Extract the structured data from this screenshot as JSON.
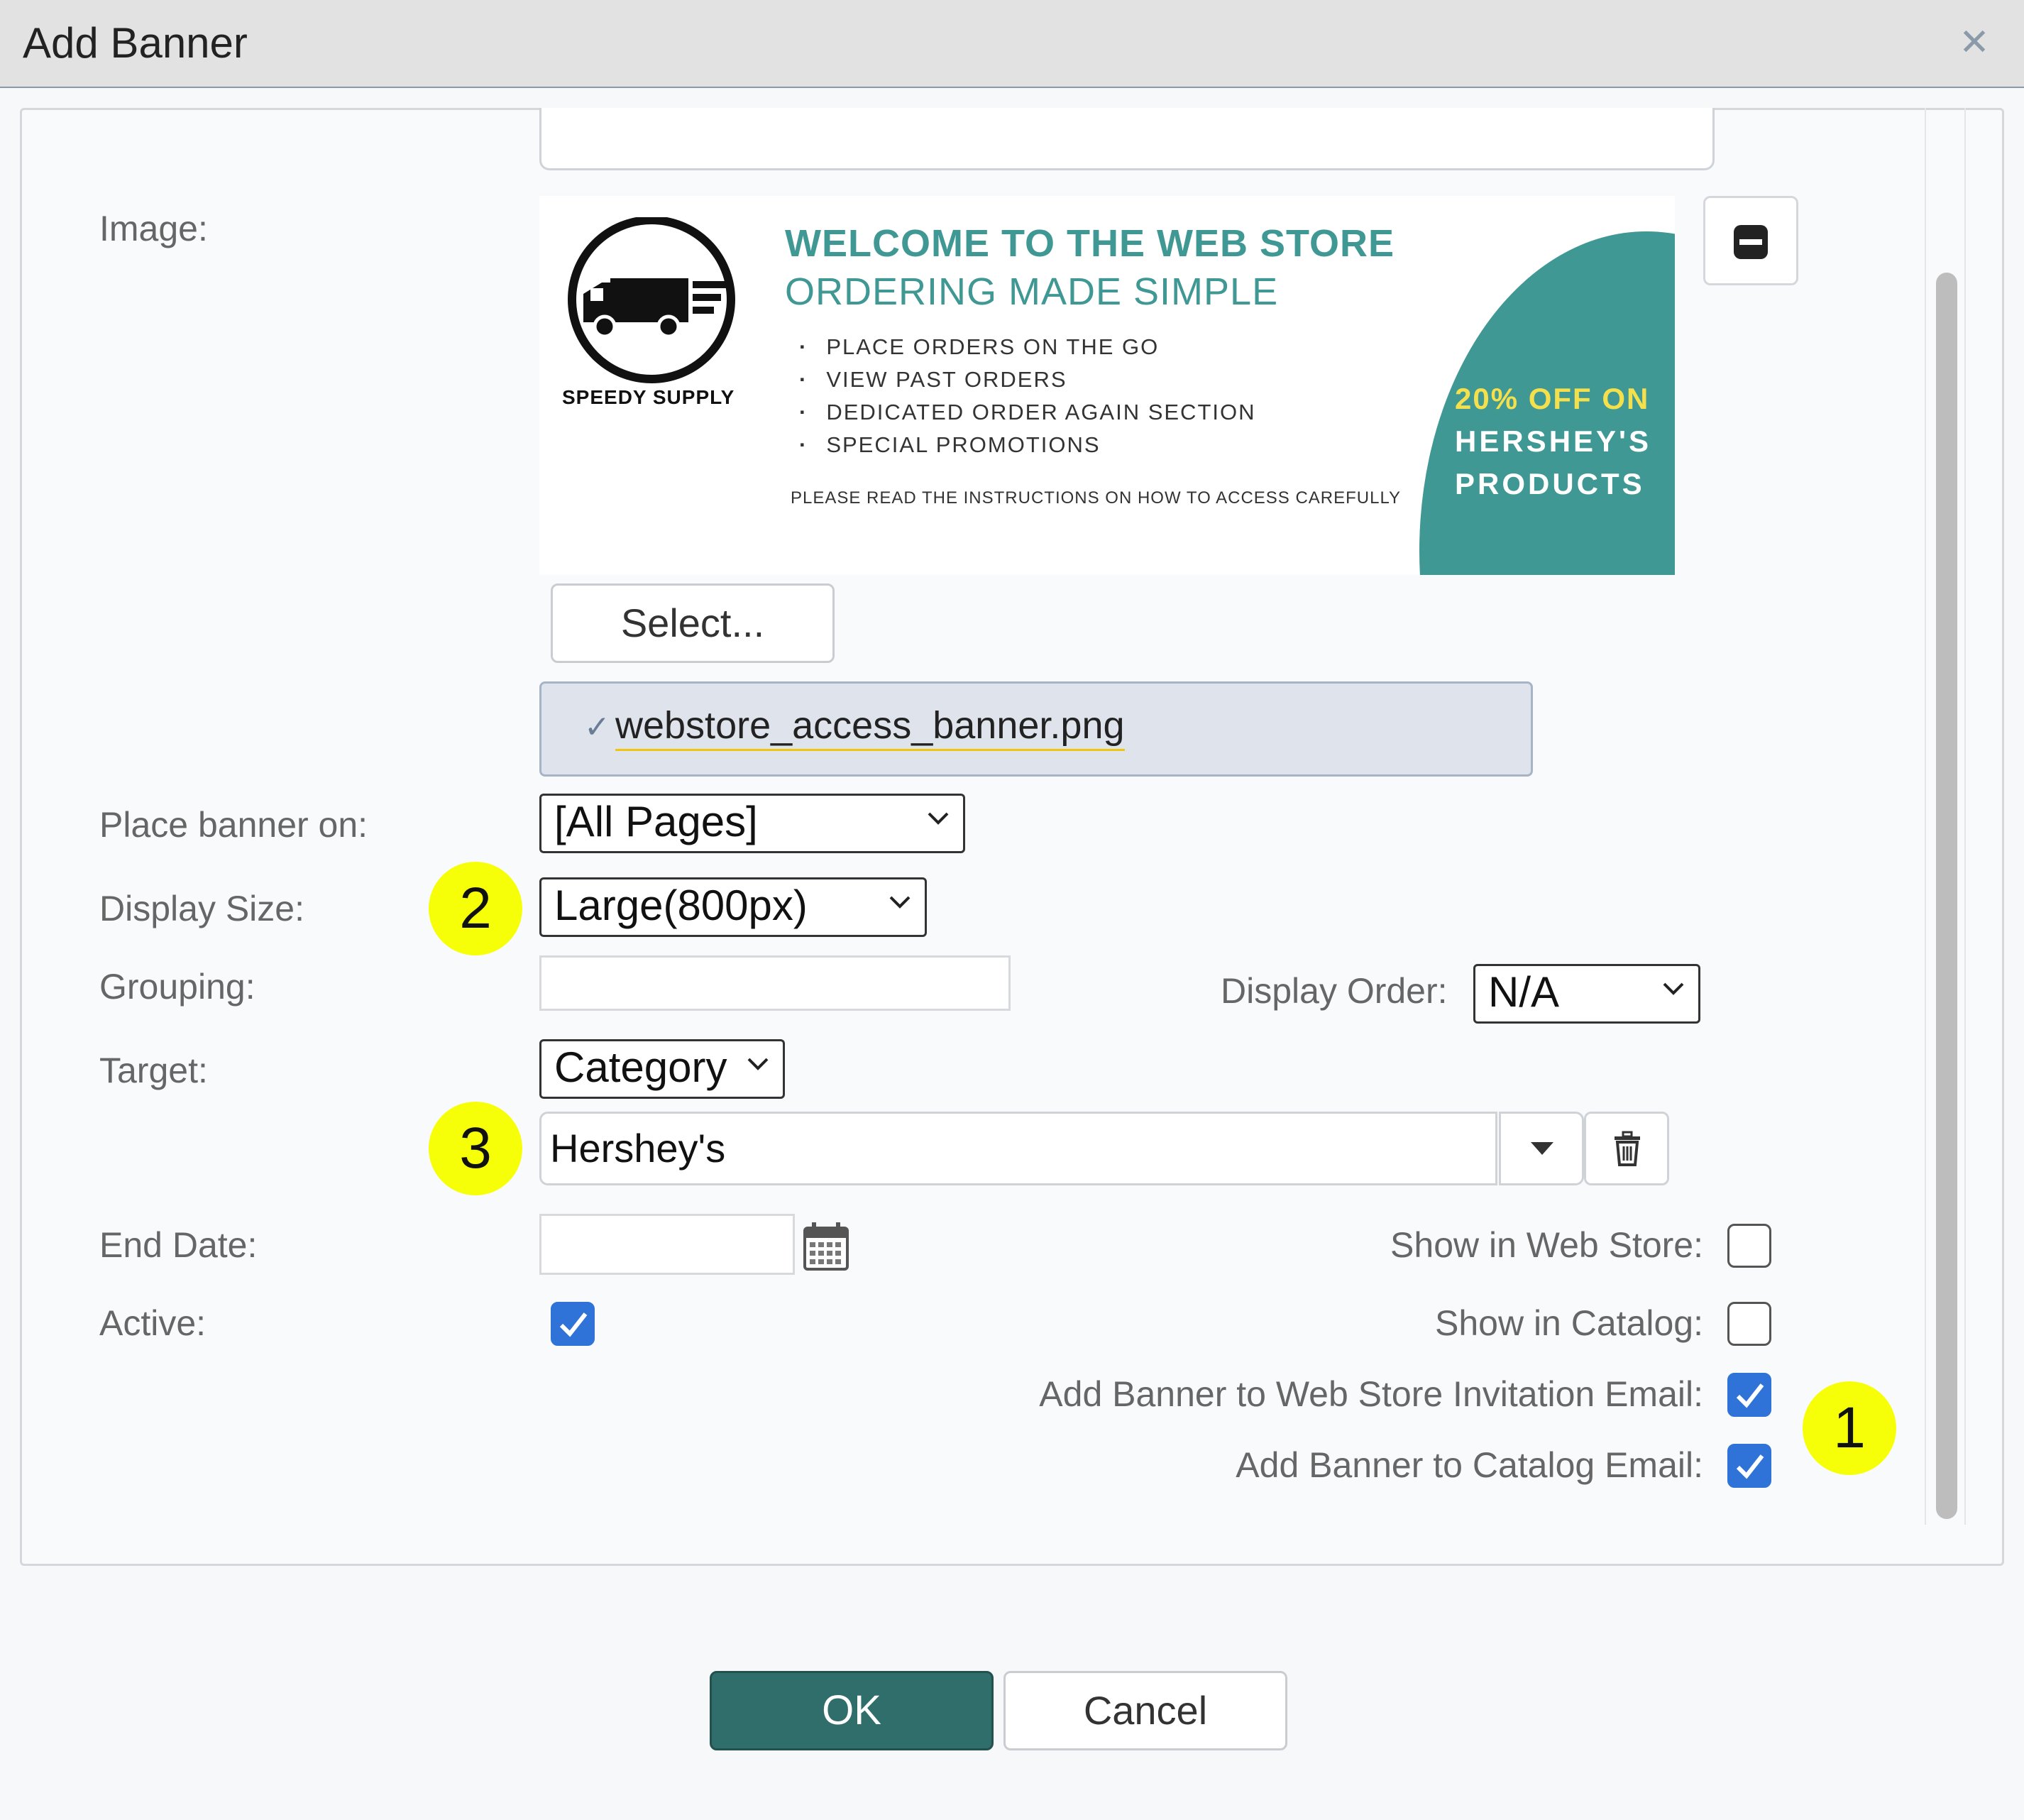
{
  "dialog": {
    "title": "Add Banner"
  },
  "image": {
    "label": "Image:",
    "banner": {
      "brand": "SPEEDY SUPPLY",
      "headline": "WELCOME TO THE WEB STORE",
      "subheadline": "ORDERING MADE SIMPLE",
      "bullets": [
        "PLACE ORDERS ON THE GO",
        "VIEW PAST ORDERS",
        "DEDICATED ORDER AGAIN SECTION",
        "SPECIAL PROMOTIONS"
      ],
      "note": "PLEASE READ THE INSTRUCTIONS ON HOW TO ACCESS CAREFULLY",
      "promo_line1": "20% OFF ON",
      "promo_line2": "HERSHEY'S",
      "promo_line3": "PRODUCTS"
    },
    "select_label": "Select...",
    "file_name": "webstore_access_banner.png"
  },
  "form": {
    "place_banner_on": {
      "label": "Place banner on:",
      "value": "[All Pages]"
    },
    "display_size": {
      "label": "Display Size:",
      "value": "Large(800px)"
    },
    "grouping": {
      "label": "Grouping:",
      "value": ""
    },
    "display_order": {
      "label": "Display Order:",
      "value": "N/A"
    },
    "target": {
      "label": "Target:",
      "value": "Category",
      "category_value": "Hershey's"
    },
    "end_date": {
      "label": "End Date:",
      "value": ""
    },
    "active": {
      "label": "Active:",
      "checked": true
    },
    "show_in_web_store": {
      "label": "Show in Web Store:",
      "checked": false
    },
    "show_in_catalog": {
      "label": "Show in Catalog:",
      "checked": false
    },
    "add_to_web_store_invitation_email": {
      "label": "Add Banner to Web Store Invitation Email:",
      "checked": true
    },
    "add_to_catalog_email": {
      "label": "Add Banner to Catalog Email:",
      "checked": true
    }
  },
  "annotations": {
    "badge1": "1",
    "badge2": "2",
    "badge3": "3"
  },
  "buttons": {
    "ok": "OK",
    "cancel": "Cancel"
  },
  "colors": {
    "accent": "#2f6e6b",
    "checkbox": "#2f73d8",
    "badge": "#f7ff08",
    "banner_teal": "#3f9893"
  }
}
